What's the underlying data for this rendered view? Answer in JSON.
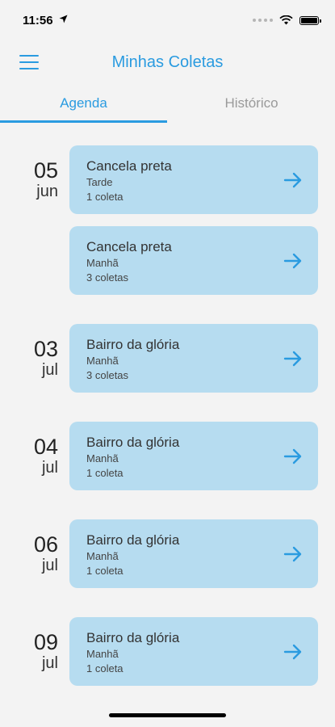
{
  "status_bar": {
    "time": "11:56"
  },
  "header": {
    "title": "Minhas Coletas"
  },
  "tabs": [
    {
      "label": "Agenda",
      "active": true
    },
    {
      "label": "Histórico",
      "active": false
    }
  ],
  "schedule": [
    {
      "day": "05",
      "month": "jun",
      "items": [
        {
          "title": "Cancela preta",
          "period": "Tarde",
          "count": "1 coleta"
        },
        {
          "title": "Cancela preta",
          "period": "Manhã",
          "count": "3 coletas"
        }
      ]
    },
    {
      "day": "03",
      "month": "jul",
      "items": [
        {
          "title": "Bairro da glória",
          "period": "Manhã",
          "count": "3 coletas"
        }
      ]
    },
    {
      "day": "04",
      "month": "jul",
      "items": [
        {
          "title": "Bairro da glória",
          "period": "Manhã",
          "count": "1 coleta"
        }
      ]
    },
    {
      "day": "06",
      "month": "jul",
      "items": [
        {
          "title": "Bairro da glória",
          "period": "Manhã",
          "count": "1 coleta"
        }
      ]
    },
    {
      "day": "09",
      "month": "jul",
      "items": [
        {
          "title": "Bairro da glória",
          "period": "Manhã",
          "count": "1 coleta"
        }
      ]
    }
  ],
  "colors": {
    "accent": "#2a9be0",
    "card_bg": "#b6dcf0",
    "background": "#f3f3f3"
  },
  "icons": {
    "menu": "hamburger-menu-icon",
    "arrow": "arrow-right-icon",
    "location": "location-arrow-icon",
    "wifi": "wifi-icon",
    "battery": "battery-icon"
  }
}
